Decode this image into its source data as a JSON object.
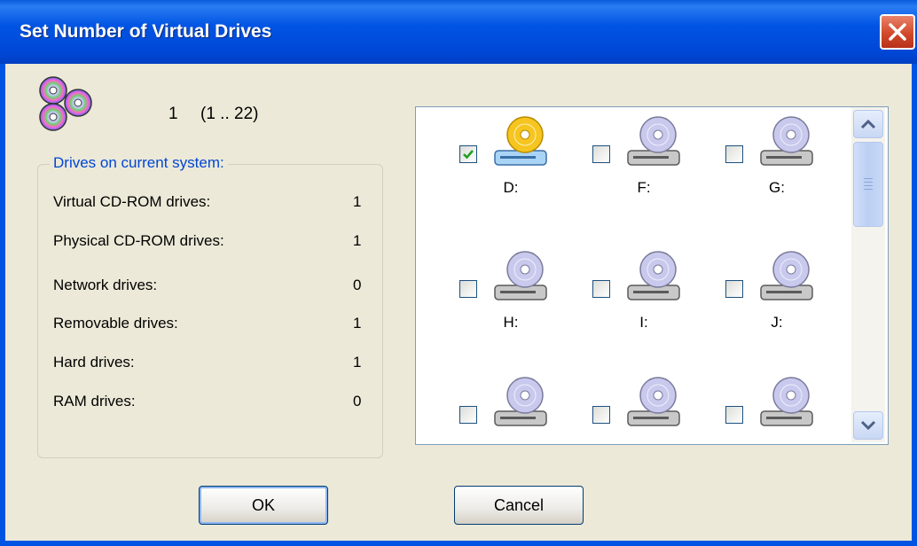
{
  "window": {
    "title": "Set Number of Virtual Drives"
  },
  "drive_count": {
    "value": "1",
    "range": "(1 .. 22)"
  },
  "group": {
    "legend": "Drives on current system:",
    "rows": [
      {
        "label": "Virtual CD-ROM drives:",
        "value": "1"
      },
      {
        "label": "Physical CD-ROM drives:",
        "value": "1"
      },
      {
        "label": "Network drives:",
        "value": "0"
      },
      {
        "label": "Removable drives:",
        "value": "1"
      },
      {
        "label": "Hard drives:",
        "value": "1"
      },
      {
        "label": "RAM drives:",
        "value": "0"
      }
    ]
  },
  "drives": [
    {
      "letter": "D:",
      "checked": true,
      "icon": "virtual-cd-drive-icon"
    },
    {
      "letter": "F:",
      "checked": false,
      "icon": "cd-drive-icon"
    },
    {
      "letter": "G:",
      "checked": false,
      "icon": "cd-drive-icon"
    },
    {
      "letter": "H:",
      "checked": false,
      "icon": "cd-drive-icon"
    },
    {
      "letter": "I:",
      "checked": false,
      "icon": "cd-drive-icon"
    },
    {
      "letter": "J:",
      "checked": false,
      "icon": "cd-drive-icon"
    },
    {
      "letter": "",
      "checked": false,
      "icon": "cd-drive-icon"
    },
    {
      "letter": "",
      "checked": false,
      "icon": "cd-drive-icon"
    },
    {
      "letter": "",
      "checked": false,
      "icon": "cd-drive-icon"
    }
  ],
  "buttons": {
    "ok": "OK",
    "cancel": "Cancel"
  },
  "colors": {
    "title_bar": "#0054e3",
    "close": "#d24a2a",
    "legend": "#0046d5",
    "dialog_bg": "#ece9d8"
  }
}
